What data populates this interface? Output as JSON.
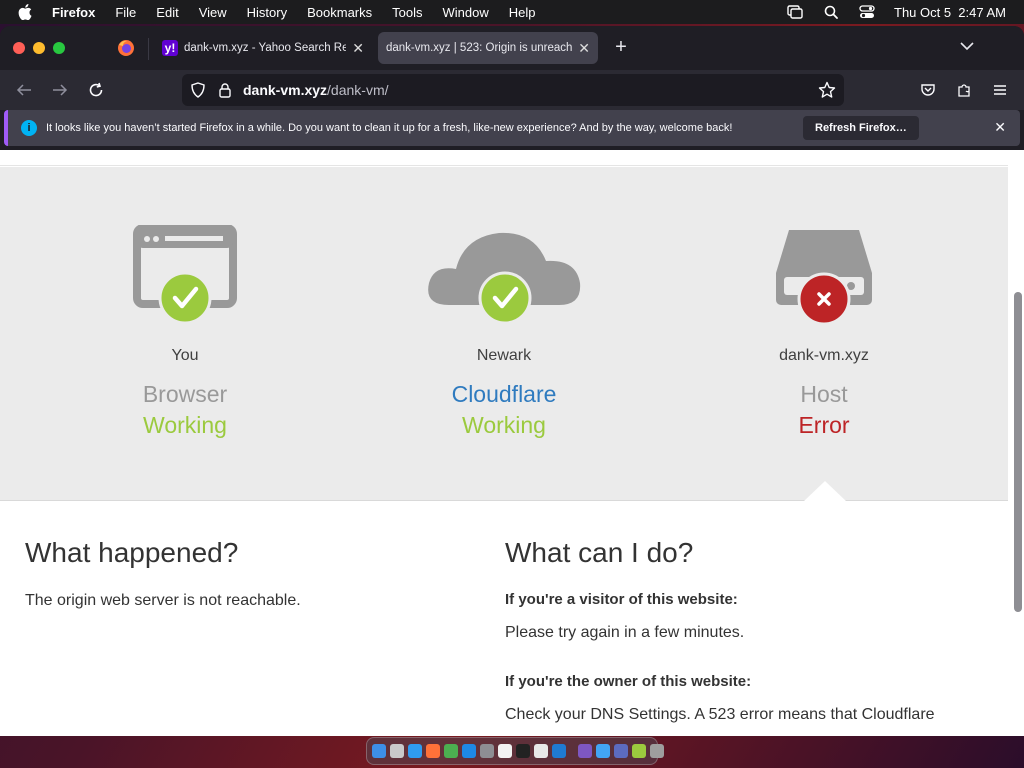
{
  "menubar": {
    "app_name": "Firefox",
    "items": [
      "File",
      "Edit",
      "View",
      "History",
      "Bookmarks",
      "Tools",
      "Window",
      "Help"
    ],
    "datetime": "Thu Oct 5  2:47 AM"
  },
  "tabs": [
    {
      "title": "dank-vm.xyz - Yahoo Search Re",
      "favicon": "y!",
      "active": false
    },
    {
      "title": "dank-vm.xyz | 523: Origin is unreach",
      "active": true
    }
  ],
  "urlbar": {
    "host": "dank-vm.xyz",
    "path": "/dank-vm/"
  },
  "notification": {
    "message": "It looks like you haven’t started Firefox in a while. Do you want to clean it up for a fresh, like-new experience? And by the way, welcome back!",
    "button": "Refresh Firefox…"
  },
  "status": {
    "browser": {
      "location": "You",
      "name": "Browser",
      "state": "Working"
    },
    "cloudflare": {
      "location": "Newark",
      "name": "Cloudflare",
      "state": "Working"
    },
    "host": {
      "location": "dank-vm.xyz",
      "name": "Host",
      "state": "Error"
    }
  },
  "what_happened": {
    "heading": "What happened?",
    "text": "The origin web server is not reachable."
  },
  "what_can_i_do": {
    "heading": "What can I do?",
    "visitor_label": "If you're a visitor of this website:",
    "visitor_text": "Please try again in a few minutes.",
    "owner_label": "If you're the owner of this website:",
    "owner_text": "Check your DNS Settings. A 523 error means that Cloudflare"
  },
  "colors": {
    "working": "#9bca3e",
    "error": "#bd2426",
    "cloudflare": "#2f7bbf"
  }
}
